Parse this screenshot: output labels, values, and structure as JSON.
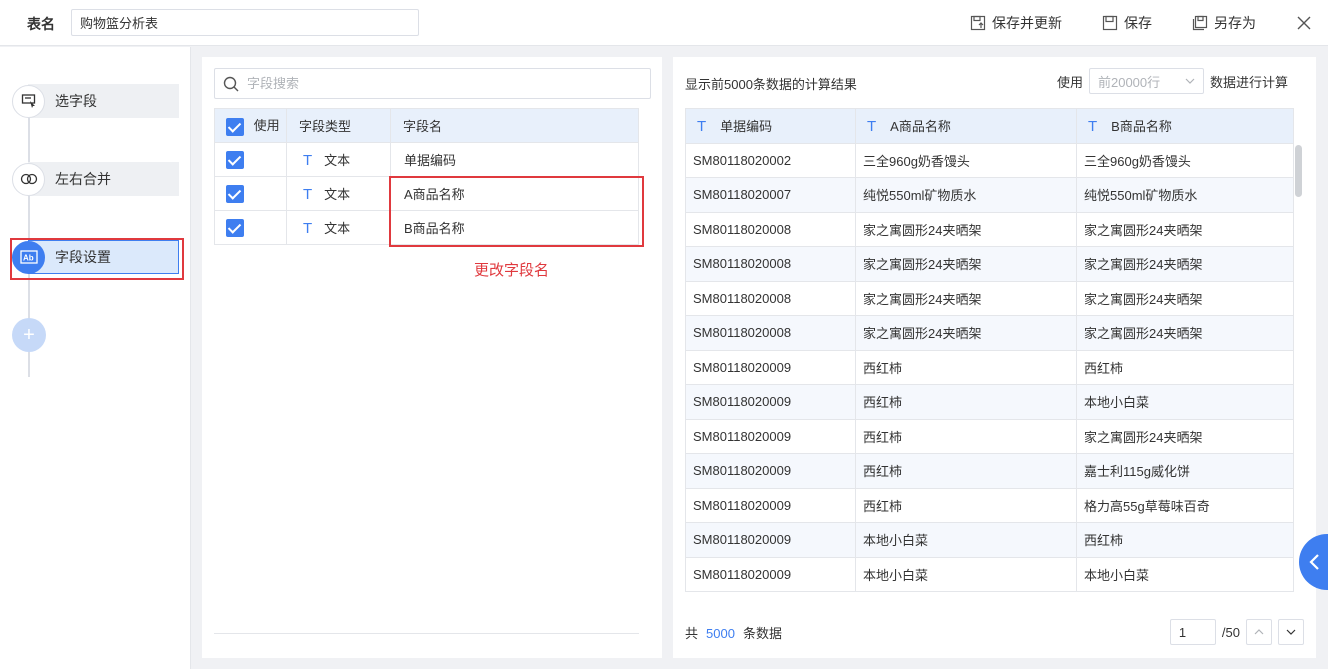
{
  "header": {
    "table_label": "表名",
    "table_name": "购物篮分析表",
    "save_update": "保存并更新",
    "save": "保存",
    "save_as": "另存为"
  },
  "steps": [
    {
      "label": "选字段",
      "icon": "field-select-icon"
    },
    {
      "label": "左右合并",
      "icon": "merge-icon"
    },
    {
      "label": "字段设置",
      "icon": "field-setting-icon"
    }
  ],
  "fields": {
    "search_placeholder": "字段搜索",
    "headers": {
      "use": "使用",
      "type": "字段类型",
      "name": "字段名"
    },
    "rows": [
      {
        "type": "文本",
        "name": "单据编码"
      },
      {
        "type": "文本",
        "name": "A商品名称"
      },
      {
        "type": "文本",
        "name": "B商品名称"
      }
    ],
    "annotation": "更改字段名"
  },
  "preview": {
    "info": "显示前5000条数据的计算结果",
    "use_label": "使用",
    "row_select": "前20000行",
    "calc_label": "数据进行计算",
    "columns": [
      "单据编码",
      "A商品名称",
      "B商品名称"
    ],
    "rows": [
      [
        "SM80118020002",
        "三全960g奶香馒头",
        "三全960g奶香馒头"
      ],
      [
        "SM80118020007",
        "纯悦550ml矿物质水",
        "纯悦550ml矿物质水"
      ],
      [
        "SM80118020008",
        "家之寓圆形24夹晒架",
        "家之寓圆形24夹晒架"
      ],
      [
        "SM80118020008",
        "家之寓圆形24夹晒架",
        "家之寓圆形24夹晒架"
      ],
      [
        "SM80118020008",
        "家之寓圆形24夹晒架",
        "家之寓圆形24夹晒架"
      ],
      [
        "SM80118020008",
        "家之寓圆形24夹晒架",
        "家之寓圆形24夹晒架"
      ],
      [
        "SM80118020009",
        "西红柿",
        "西红柿"
      ],
      [
        "SM80118020009",
        "西红柿",
        "本地小白菜"
      ],
      [
        "SM80118020009",
        "西红柿",
        "家之寓圆形24夹晒架"
      ],
      [
        "SM80118020009",
        "西红柿",
        "嘉士利115g威化饼"
      ],
      [
        "SM80118020009",
        "西红柿",
        "格力高55g草莓味百奇"
      ],
      [
        "SM80118020009",
        "本地小白菜",
        "西红柿"
      ],
      [
        "SM80118020009",
        "本地小白菜",
        "本地小白菜"
      ]
    ],
    "footer": {
      "prefix": "共",
      "count": "5000",
      "suffix": "条数据"
    },
    "pager": {
      "page": "1",
      "total": "/50"
    }
  }
}
